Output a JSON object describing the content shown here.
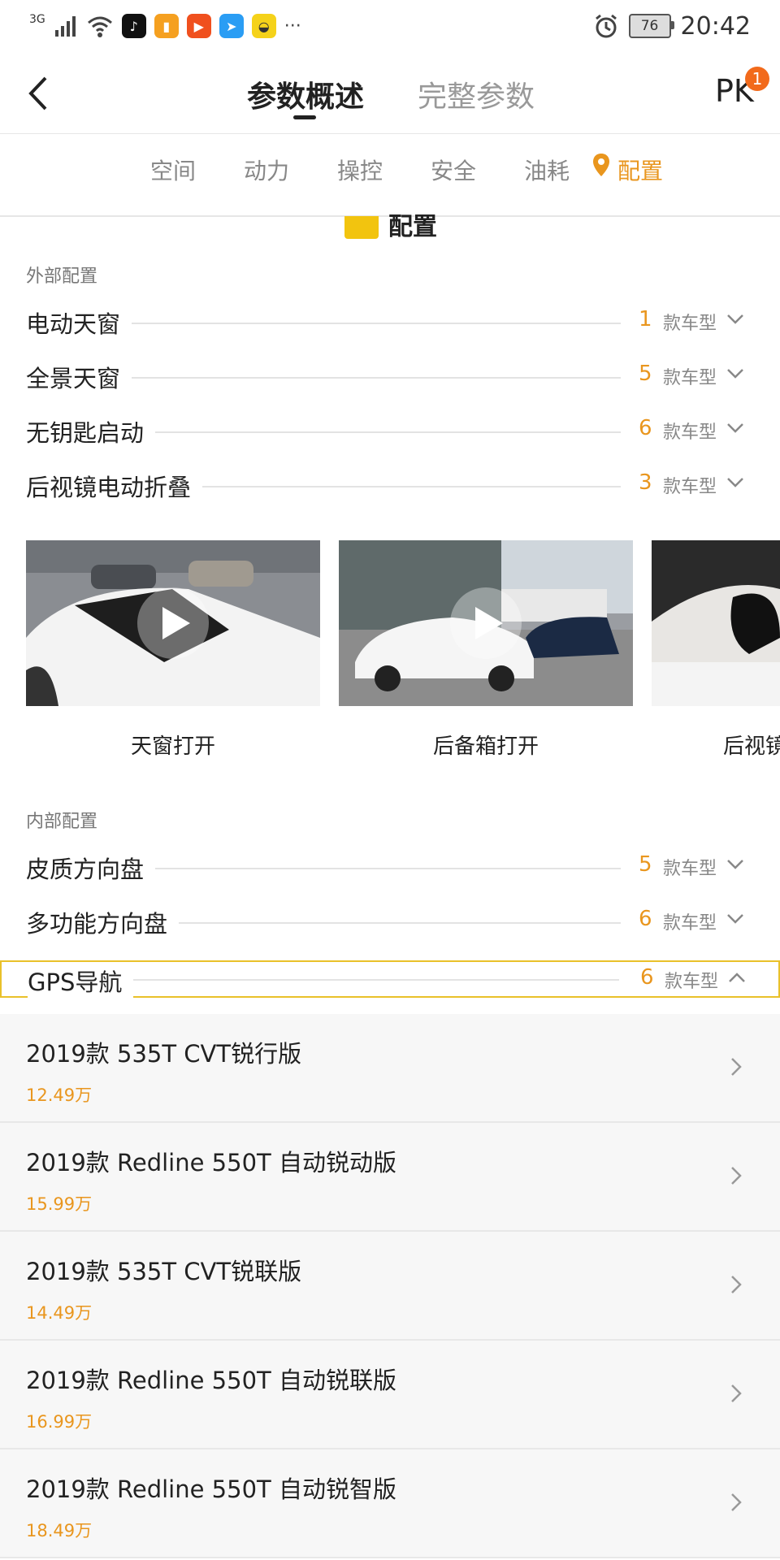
{
  "status_bar": {
    "network": "3G",
    "battery": "76",
    "time": "20:42",
    "more": "···"
  },
  "header": {
    "tabs": [
      {
        "label": "参数概述",
        "active": true
      },
      {
        "label": "完整参数",
        "active": false
      }
    ],
    "pk_label": "PK",
    "pk_badge": "1"
  },
  "subnav": {
    "items": [
      {
        "label": "空间",
        "active": false
      },
      {
        "label": "动力",
        "active": false
      },
      {
        "label": "操控",
        "active": false
      },
      {
        "label": "安全",
        "active": false
      },
      {
        "label": "油耗",
        "active": false
      },
      {
        "label": "配置",
        "active": true
      }
    ]
  },
  "section": {
    "title": "配置"
  },
  "exterior": {
    "label": "外部配置",
    "rows": [
      {
        "name": "电动天窗",
        "count": "1",
        "unit": "款车型"
      },
      {
        "name": "全景天窗",
        "count": "5",
        "unit": "款车型"
      },
      {
        "name": "无钥匙启动",
        "count": "6",
        "unit": "款车型"
      },
      {
        "name": "后视镜电动折叠",
        "count": "3",
        "unit": "款车型"
      }
    ]
  },
  "gallery": {
    "items": [
      {
        "caption": "天窗打开"
      },
      {
        "caption": "后备箱打开"
      },
      {
        "caption": "后视镜"
      }
    ]
  },
  "interior": {
    "label": "内部配置",
    "rows": [
      {
        "name": "皮质方向盘",
        "count": "5",
        "unit": "款车型"
      },
      {
        "name": "多功能方向盘",
        "count": "6",
        "unit": "款车型"
      },
      {
        "name": "GPS导航",
        "count": "6",
        "unit": "款车型",
        "expanded": true
      }
    ]
  },
  "models": [
    {
      "name": "2019款 535T CVT锐行版",
      "price": "12.49万"
    },
    {
      "name": "2019款 Redline 550T 自动锐动版",
      "price": "15.99万"
    },
    {
      "name": "2019款 535T CVT锐联版",
      "price": "14.49万"
    },
    {
      "name": "2019款 Redline 550T 自动锐联版",
      "price": "16.99万"
    },
    {
      "name": "2019款 Redline 550T 自动锐智版",
      "price": "18.49万"
    }
  ],
  "colors": {
    "accent": "#e9961e",
    "badge": "#f26a1b",
    "highlight_border": "#e9c12a"
  }
}
